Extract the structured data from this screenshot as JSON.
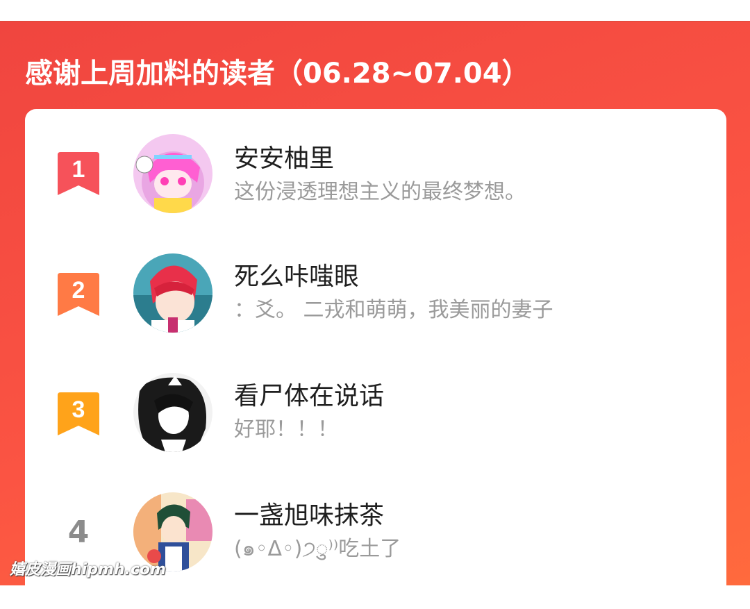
{
  "header": {
    "title": "感谢上周加料的读者（06.28~07.04）"
  },
  "colors": {
    "panel_gradient": [
      "#f0453f",
      "#ff6a3d"
    ],
    "rank1": "#f6525a",
    "rank2": "#ff7a45",
    "rank3": "#ffa31a",
    "rank_plain": "#8c8c8c"
  },
  "readers": [
    {
      "rank": "1",
      "badge_icon": "ribbon-bookmark-icon",
      "avatar_icon": "anime-avatar-pink-hair",
      "name": "安安柚里",
      "message": "这份浸透理想主义的最终梦想。"
    },
    {
      "rank": "2",
      "badge_icon": "ribbon-bookmark-icon",
      "avatar_icon": "anime-avatar-red-hair",
      "name": "死么咔嗤眼",
      "message": "：爻。 二戎和萌萌，我美丽的妻子"
    },
    {
      "rank": "3",
      "badge_icon": "ribbon-bookmark-icon",
      "avatar_icon": "anime-avatar-monochrome",
      "name": "看尸体在说话",
      "message": "好耶！！！"
    },
    {
      "rank": "4",
      "avatar_icon": "anime-avatar-green-hair",
      "name": "一盏旭味抹茶",
      "message": "(๑◦ᐃ◦)੭ु⁾⁾吃土了"
    }
  ],
  "watermark": "嬉皮漫画hipmh.com"
}
